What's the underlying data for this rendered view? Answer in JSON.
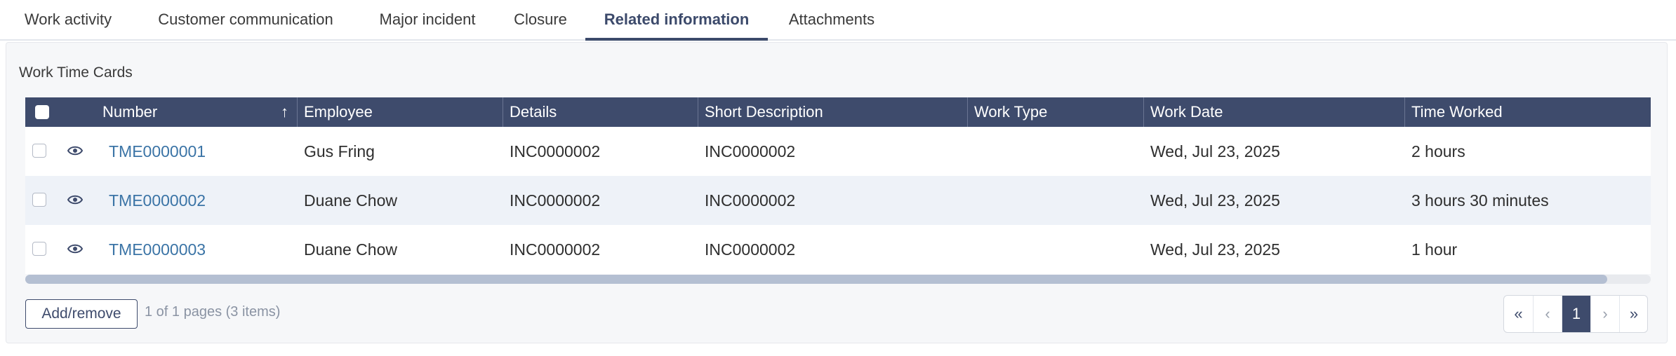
{
  "tabs": [
    {
      "label": "Work activity",
      "active": false
    },
    {
      "label": "Customer communication",
      "active": false
    },
    {
      "label": "Major incident",
      "active": false
    },
    {
      "label": "Closure",
      "active": false
    },
    {
      "label": "Related information",
      "active": true
    },
    {
      "label": "Attachments",
      "active": false
    }
  ],
  "section": {
    "title": "Work Time Cards"
  },
  "table": {
    "columns": [
      "Number",
      "Employee",
      "Details",
      "Short Description",
      "Work Type",
      "Work Date",
      "Time Worked"
    ],
    "sort": {
      "column": "Number",
      "direction": "ascending",
      "icon": "arrow-up-icon"
    },
    "rows": [
      {
        "number": "TME0000001",
        "employee": "Gus Fring",
        "details": "INC0000002",
        "short_description": "INC0000002",
        "work_type": "",
        "work_date": "Wed, Jul 23, 2025",
        "time_worked": "2 hours"
      },
      {
        "number": "TME0000002",
        "employee": "Duane Chow",
        "details": "INC0000002",
        "short_description": "INC0000002",
        "work_type": "",
        "work_date": "Wed, Jul 23, 2025",
        "time_worked": "3 hours 30 minutes"
      },
      {
        "number": "TME0000003",
        "employee": "Duane Chow",
        "details": "INC0000002",
        "short_description": "INC0000002",
        "work_type": "",
        "work_date": "Wed, Jul 23, 2025",
        "time_worked": "1 hour"
      }
    ]
  },
  "footer": {
    "add_remove_label": "Add/remove",
    "page_info": "1 of 1 pages (3 items)",
    "pager": {
      "first": "«",
      "prev": "‹",
      "current": "1",
      "next": "›",
      "last": "»"
    }
  },
  "colors": {
    "header_bg": "#3e4b6c",
    "link": "#3b74a6",
    "active_tab": "#3c4a6b"
  }
}
